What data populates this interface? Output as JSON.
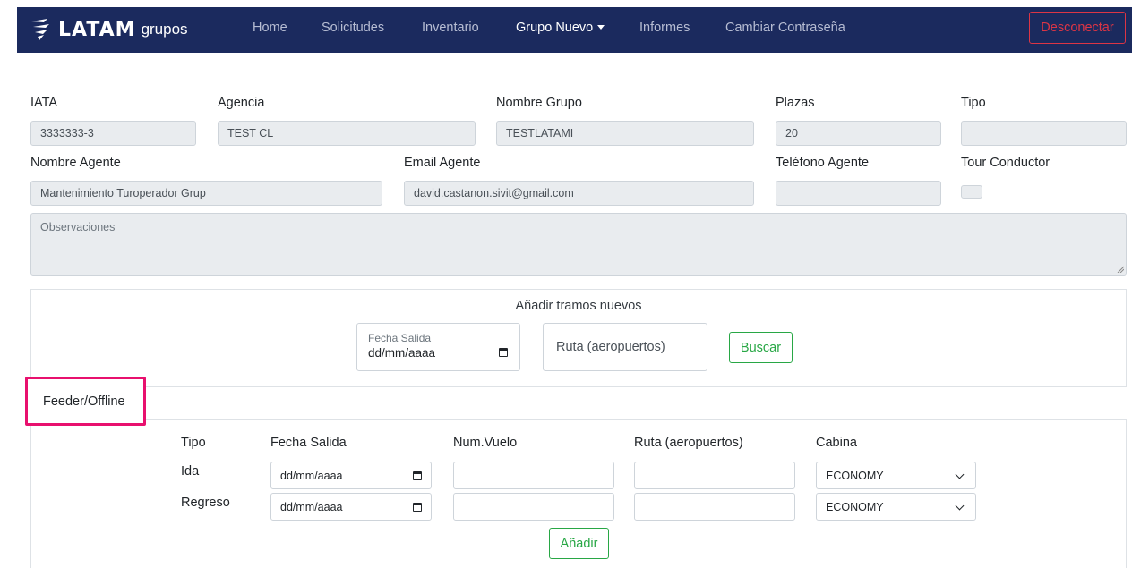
{
  "nav": {
    "brand": "LATAM",
    "brand_sub": "grupos",
    "links": [
      "Home",
      "Solicitudes",
      "Inventario",
      "Grupo Nuevo",
      "Informes",
      "Cambiar Contraseña"
    ],
    "logout": "Desconectar"
  },
  "form": {
    "iata_label": "IATA",
    "iata_value": "3333333-3",
    "agencia_label": "Agencia",
    "agencia_value": "TEST CL",
    "nombre_grupo_label": "Nombre Grupo",
    "nombre_grupo_value": "TESTLATAMI",
    "plazas_label": "Plazas",
    "plazas_value": "20",
    "tipo_label": "Tipo",
    "tipo_value": "",
    "nombre_agente_label": "Nombre Agente",
    "nombre_agente_value": "Mantenimiento Turoperador Grup",
    "email_agente_label": "Email Agente",
    "email_agente_value": "david.castanon.sivit@gmail.com",
    "telefono_agente_label": "Teléfono Agente",
    "telefono_agente_value": "",
    "tour_conductor_label": "Tour Conductor",
    "observaciones_placeholder": "Observaciones"
  },
  "tramos": {
    "title": "Añadir tramos nuevos",
    "fecha_label": "Fecha Salida",
    "fecha_value": "dd/mm/aaaa",
    "ruta_placeholder": "Ruta (aeropuertos)",
    "buscar": "Buscar"
  },
  "feeder": {
    "tab": "Feeder/Offline",
    "headers": [
      "Tipo",
      "Fecha Salida",
      "Num.Vuelo",
      "Ruta (aeropuertos)",
      "Cabina"
    ],
    "rows": [
      {
        "tipo": "Ida",
        "fecha": "dd/mm/aaaa",
        "vuelo": "",
        "ruta": "",
        "cabina": "ECONOMY"
      },
      {
        "tipo": "Regreso",
        "fecha": "dd/mm/aaaa",
        "vuelo": "",
        "ruta": "",
        "cabina": "ECONOMY"
      }
    ],
    "add": "Añadir"
  },
  "colors": {
    "navbar": "#1b2a5e",
    "danger": "#dc3545",
    "success": "#28a745",
    "highlight": "#e8106e"
  }
}
